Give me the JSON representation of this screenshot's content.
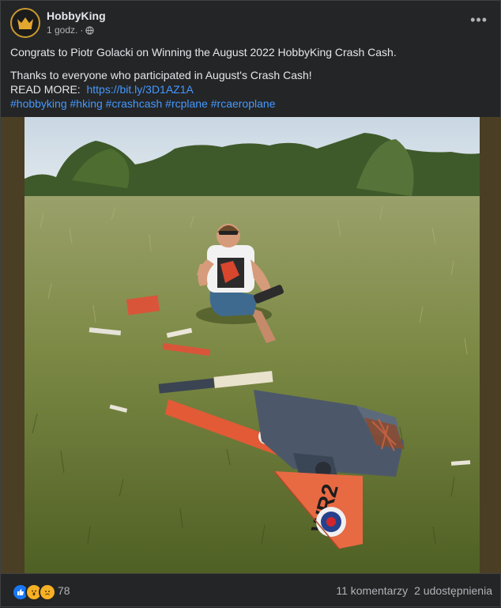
{
  "post": {
    "author": "HobbyKing",
    "time": "1 godz.",
    "separator": "·",
    "line1": "Congrats to Piotr Golacki on Winning the August 2022 HobbyKing Crash Cash.",
    "line2": "Thanks to everyone who participated in August's Crash Cash!",
    "read_more_label": "READ MORE:",
    "read_more_link": "https://bit.ly/3D1AZ1A",
    "hashtags": [
      "#hobbyking",
      "#hking",
      "#crashcash",
      "#rcplane",
      "#rcaeroplane"
    ],
    "plane_marking": "WR2"
  },
  "footer": {
    "reaction_count": "78",
    "comments": "11 komentarzy",
    "shares": "2 udostępnienia"
  },
  "icons": {
    "menu": "more-options-icon",
    "privacy": "globe-icon",
    "reactions": [
      "like-icon",
      "wow-icon",
      "sad-icon"
    ]
  },
  "colors": {
    "background": "#242526",
    "text": "#e4e6eb",
    "secondary": "#b0b3b8",
    "link": "#4599ff",
    "like": "#1877f2",
    "reaction_yellow": "#f7b125"
  }
}
